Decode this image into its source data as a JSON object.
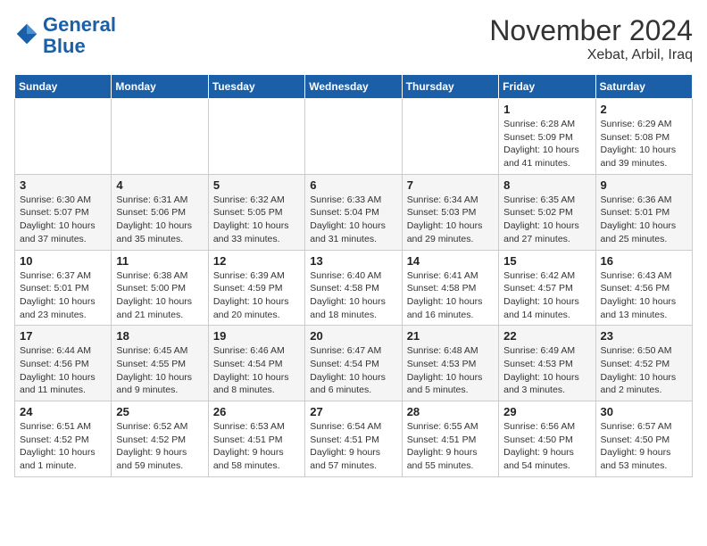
{
  "app": {
    "name_line1": "General",
    "name_line2": "Blue"
  },
  "header": {
    "month": "November 2024",
    "location": "Xebat, Arbil, Iraq"
  },
  "days_of_week": [
    "Sunday",
    "Monday",
    "Tuesday",
    "Wednesday",
    "Thursday",
    "Friday",
    "Saturday"
  ],
  "weeks": [
    [
      {
        "day": "",
        "content": ""
      },
      {
        "day": "",
        "content": ""
      },
      {
        "day": "",
        "content": ""
      },
      {
        "day": "",
        "content": ""
      },
      {
        "day": "",
        "content": ""
      },
      {
        "day": "1",
        "content": "Sunrise: 6:28 AM\nSunset: 5:09 PM\nDaylight: 10 hours and 41 minutes."
      },
      {
        "day": "2",
        "content": "Sunrise: 6:29 AM\nSunset: 5:08 PM\nDaylight: 10 hours and 39 minutes."
      }
    ],
    [
      {
        "day": "3",
        "content": "Sunrise: 6:30 AM\nSunset: 5:07 PM\nDaylight: 10 hours and 37 minutes."
      },
      {
        "day": "4",
        "content": "Sunrise: 6:31 AM\nSunset: 5:06 PM\nDaylight: 10 hours and 35 minutes."
      },
      {
        "day": "5",
        "content": "Sunrise: 6:32 AM\nSunset: 5:05 PM\nDaylight: 10 hours and 33 minutes."
      },
      {
        "day": "6",
        "content": "Sunrise: 6:33 AM\nSunset: 5:04 PM\nDaylight: 10 hours and 31 minutes."
      },
      {
        "day": "7",
        "content": "Sunrise: 6:34 AM\nSunset: 5:03 PM\nDaylight: 10 hours and 29 minutes."
      },
      {
        "day": "8",
        "content": "Sunrise: 6:35 AM\nSunset: 5:02 PM\nDaylight: 10 hours and 27 minutes."
      },
      {
        "day": "9",
        "content": "Sunrise: 6:36 AM\nSunset: 5:01 PM\nDaylight: 10 hours and 25 minutes."
      }
    ],
    [
      {
        "day": "10",
        "content": "Sunrise: 6:37 AM\nSunset: 5:01 PM\nDaylight: 10 hours and 23 minutes."
      },
      {
        "day": "11",
        "content": "Sunrise: 6:38 AM\nSunset: 5:00 PM\nDaylight: 10 hours and 21 minutes."
      },
      {
        "day": "12",
        "content": "Sunrise: 6:39 AM\nSunset: 4:59 PM\nDaylight: 10 hours and 20 minutes."
      },
      {
        "day": "13",
        "content": "Sunrise: 6:40 AM\nSunset: 4:58 PM\nDaylight: 10 hours and 18 minutes."
      },
      {
        "day": "14",
        "content": "Sunrise: 6:41 AM\nSunset: 4:58 PM\nDaylight: 10 hours and 16 minutes."
      },
      {
        "day": "15",
        "content": "Sunrise: 6:42 AM\nSunset: 4:57 PM\nDaylight: 10 hours and 14 minutes."
      },
      {
        "day": "16",
        "content": "Sunrise: 6:43 AM\nSunset: 4:56 PM\nDaylight: 10 hours and 13 minutes."
      }
    ],
    [
      {
        "day": "17",
        "content": "Sunrise: 6:44 AM\nSunset: 4:56 PM\nDaylight: 10 hours and 11 minutes."
      },
      {
        "day": "18",
        "content": "Sunrise: 6:45 AM\nSunset: 4:55 PM\nDaylight: 10 hours and 9 minutes."
      },
      {
        "day": "19",
        "content": "Sunrise: 6:46 AM\nSunset: 4:54 PM\nDaylight: 10 hours and 8 minutes."
      },
      {
        "day": "20",
        "content": "Sunrise: 6:47 AM\nSunset: 4:54 PM\nDaylight: 10 hours and 6 minutes."
      },
      {
        "day": "21",
        "content": "Sunrise: 6:48 AM\nSunset: 4:53 PM\nDaylight: 10 hours and 5 minutes."
      },
      {
        "day": "22",
        "content": "Sunrise: 6:49 AM\nSunset: 4:53 PM\nDaylight: 10 hours and 3 minutes."
      },
      {
        "day": "23",
        "content": "Sunrise: 6:50 AM\nSunset: 4:52 PM\nDaylight: 10 hours and 2 minutes."
      }
    ],
    [
      {
        "day": "24",
        "content": "Sunrise: 6:51 AM\nSunset: 4:52 PM\nDaylight: 10 hours and 1 minute."
      },
      {
        "day": "25",
        "content": "Sunrise: 6:52 AM\nSunset: 4:52 PM\nDaylight: 9 hours and 59 minutes."
      },
      {
        "day": "26",
        "content": "Sunrise: 6:53 AM\nSunset: 4:51 PM\nDaylight: 9 hours and 58 minutes."
      },
      {
        "day": "27",
        "content": "Sunrise: 6:54 AM\nSunset: 4:51 PM\nDaylight: 9 hours and 57 minutes."
      },
      {
        "day": "28",
        "content": "Sunrise: 6:55 AM\nSunset: 4:51 PM\nDaylight: 9 hours and 55 minutes."
      },
      {
        "day": "29",
        "content": "Sunrise: 6:56 AM\nSunset: 4:50 PM\nDaylight: 9 hours and 54 minutes."
      },
      {
        "day": "30",
        "content": "Sunrise: 6:57 AM\nSunset: 4:50 PM\nDaylight: 9 hours and 53 minutes."
      }
    ]
  ]
}
